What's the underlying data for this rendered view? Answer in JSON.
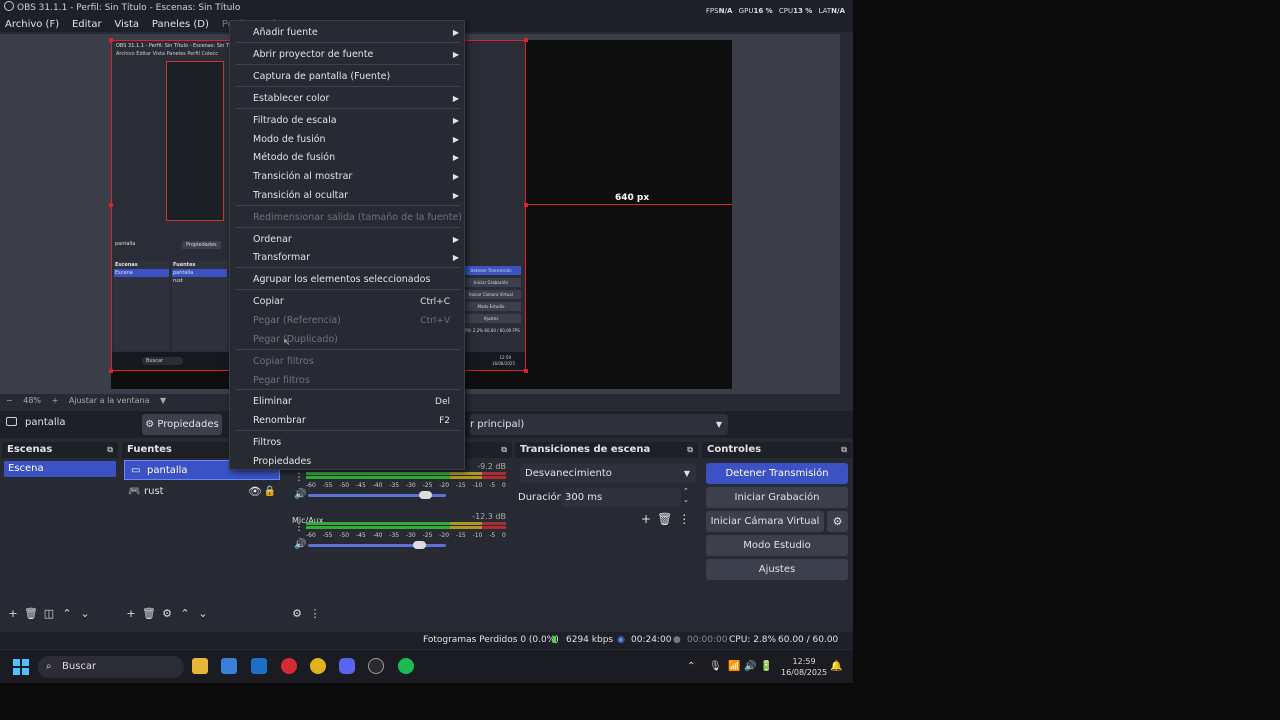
{
  "window": {
    "title": "OBS 31.1.1 - Perfil: Sin Título - Escenas: Sin Título",
    "stats": {
      "fps_label": "FPS",
      "fps_val": "N/A",
      "gpu_label": "GPU",
      "gpu_val": "16 %",
      "cpu_label": "CPU",
      "cpu_val": "13 %",
      "lat_label": "LAT",
      "lat_val": "N/A"
    }
  },
  "menubar": [
    "Archivo (F)",
    "Editar",
    "Vista",
    "Paneles (D)",
    "Perfil",
    "Colecc"
  ],
  "preview": {
    "px_label": "640 px",
    "zoom": "48%",
    "fit_label": "Ajustar a la ventana",
    "zoom_minus": "−",
    "zoom_plus": "+"
  },
  "mini": {
    "title": "OBS 31.1.1 - Perfil: Sin Título - Escenas: Sin Título",
    "menu": "Archivo  Editar  Vista  Paneles  Perfil  Colecc",
    "src": "pantalla",
    "prop": "Propiedades",
    "scenes": "Escenas",
    "scene": "Escena",
    "fuentes": "Fuentes",
    "s1": "pantalla",
    "s2": "rust",
    "buttons": [
      "Detener Transmisión",
      "Iniciar Grabación",
      "Iniciar Cámara Virtual",
      "Modo Estudio",
      "Ajustes"
    ],
    "search": "Buscar",
    "status": "CPU: 2.2%   60.00 / 60.00 FPS",
    "time": "12:59",
    "date": "16/08/2025"
  },
  "source_bar": {
    "name": "pantalla",
    "properties": "Propiedades",
    "dropdown": "r principal)"
  },
  "docks": {
    "scenes": {
      "title": "Escenas",
      "items": [
        "Escena"
      ]
    },
    "sources": {
      "title": "Fuentes",
      "items": [
        {
          "name": "pantalla",
          "icon": "monitor-icon"
        },
        {
          "name": "rust",
          "icon": "gamepad-icon"
        }
      ]
    },
    "audio": {
      "tracks": [
        {
          "name": "",
          "db": "-9.2 dB",
          "volume_fraction": 0.88
        },
        {
          "name": "Mic/Aux",
          "db": "-12.3 dB",
          "volume_fraction": 0.83
        }
      ],
      "scale": [
        "-60",
        "-55",
        "-50",
        "-45",
        "-40",
        "-35",
        "-30",
        "-25",
        "-20",
        "-15",
        "-10",
        "-5",
        "0"
      ]
    },
    "transitions": {
      "title": "Transiciones de escena",
      "selected": "Desvanecimiento",
      "duration_label": "Duración",
      "duration": "300 ms"
    },
    "controls": {
      "title": "Controles",
      "stream": "Detener Transmisión",
      "record": "Iniciar Grabación",
      "virtual_cam": "Iniciar Cámara Virtual",
      "studio": "Modo Estudio",
      "settings": "Ajustes"
    }
  },
  "statusbar": {
    "dropped": "Fotogramas Perdidos 0 (0.0%)",
    "kbps": "6294 kbps",
    "stream_time": "00:24:00",
    "rec_time": "00:00:00",
    "cpu": "CPU: 2.8%",
    "fps": "60.00 / 60.00 FPS"
  },
  "taskbar": {
    "search": "Buscar",
    "time": "12:59",
    "date": "16/08/2025"
  },
  "context_menu": [
    {
      "label": "Añadir fuente",
      "submenu": true
    },
    {
      "label": "Abrir proyector de fuente",
      "submenu": true
    },
    {
      "label": "Captura de pantalla (Fuente)"
    },
    {
      "label": "Establecer color",
      "submenu": true
    },
    {
      "label": "Filtrado de escala",
      "submenu": true
    },
    {
      "label": "Modo de fusión",
      "submenu": true
    },
    {
      "label": "Método de fusión",
      "submenu": true
    },
    {
      "label": "Transición al mostrar",
      "submenu": true
    },
    {
      "label": "Transición al ocultar",
      "submenu": true
    },
    {
      "label": "Redimensionar salida (tamaño de la fuente)",
      "disabled": true
    },
    {
      "label": "Ordenar",
      "submenu": true
    },
    {
      "label": "Transformar",
      "submenu": true
    },
    {
      "label": "Agrupar los elementos seleccionados"
    },
    {
      "label": "Copiar",
      "shortcut": "Ctrl+C"
    },
    {
      "label": "Pegar (Referencia)",
      "shortcut": "Ctrl+V",
      "disabled": true
    },
    {
      "label": "Pegar (Duplicado)",
      "disabled": true
    },
    {
      "label": "Copiar filtros",
      "disabled": true
    },
    {
      "label": "Pegar filtros",
      "disabled": true
    },
    {
      "label": "Eliminar",
      "shortcut": "Del"
    },
    {
      "label": "Renombrar",
      "shortcut": "F2"
    },
    {
      "label": "Filtros"
    },
    {
      "label": "Propiedades"
    }
  ]
}
